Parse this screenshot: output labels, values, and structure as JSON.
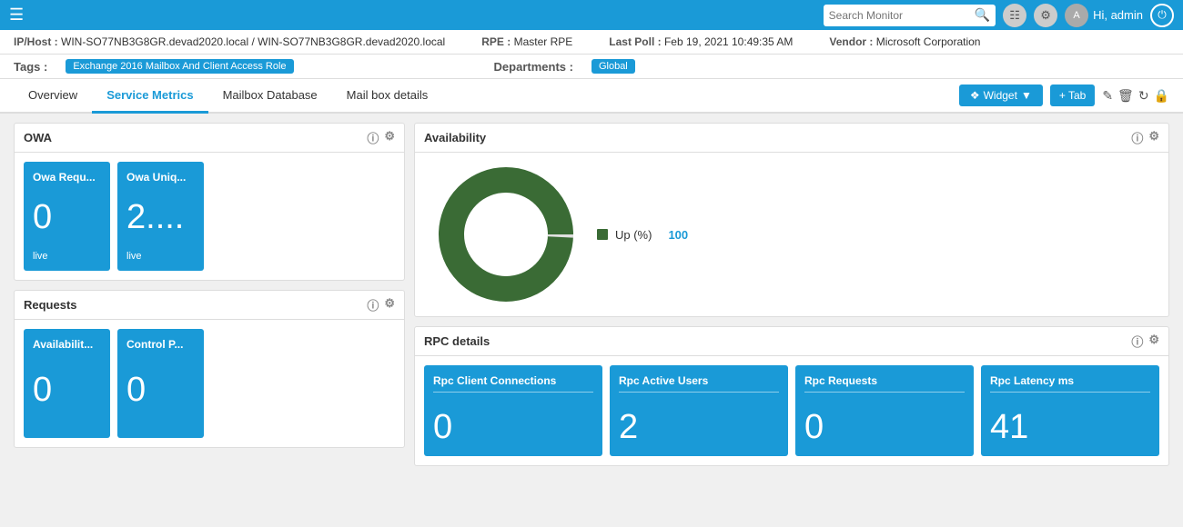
{
  "topbar": {
    "search_placeholder": "Search Monitor",
    "user_greeting": "Hi, admin"
  },
  "infobar": {
    "ip_label": "IP/Host :",
    "ip_value": "WIN-SO77NB3G8GR.devad2020.local / WIN-SO77NB3G8GR.devad2020.local",
    "rpe_label": "RPE :",
    "rpe_value": "Master RPE",
    "last_poll_label": "Last Poll :",
    "last_poll_value": "Feb 19, 2021 10:49:35 AM",
    "vendor_label": "Vendor :",
    "vendor_value": "Microsoft Corporation"
  },
  "tags": {
    "label": "Tags :",
    "tag_value": "Exchange 2016 Mailbox And Client Access Role",
    "dept_label": "Departments :",
    "dept_value": "Global"
  },
  "tabs": [
    {
      "label": "Overview",
      "active": false
    },
    {
      "label": "Service Metrics",
      "active": true
    },
    {
      "label": "Mailbox Database",
      "active": false
    },
    {
      "label": "Mail box details",
      "active": false
    }
  ],
  "toolbar": {
    "widget_label": "Widget",
    "tab_label": "+ Tab"
  },
  "owa_section": {
    "title": "OWA",
    "cards": [
      {
        "title": "Owa Requ...",
        "value": "0",
        "footer": "live"
      },
      {
        "title": "Owa Uniq...",
        "value": "2....",
        "footer": "live"
      }
    ]
  },
  "availability_section": {
    "title": "Availability",
    "legend": [
      {
        "label": "Up (%)",
        "value": "100",
        "color": "#3a6b35"
      }
    ]
  },
  "requests_section": {
    "title": "Requests",
    "cards": [
      {
        "title": "Availabilit...",
        "value": "0",
        "footer": ""
      },
      {
        "title": "Control P...",
        "value": "0",
        "footer": ""
      }
    ]
  },
  "rpc_section": {
    "title": "RPC details",
    "cards": [
      {
        "title": "Rpc Client Connections",
        "value": "0"
      },
      {
        "title": "Rpc Active Users",
        "value": "2"
      },
      {
        "title": "Rpc Requests",
        "value": "0"
      },
      {
        "title": "Rpc Latency ms",
        "value": "41"
      }
    ]
  }
}
